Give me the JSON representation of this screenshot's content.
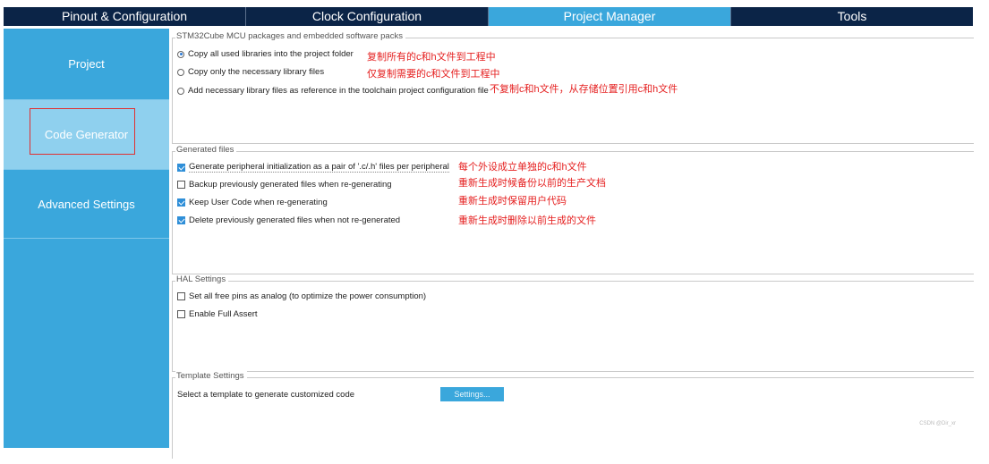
{
  "tabs": [
    "Pinout & Configuration",
    "Clock Configuration",
    "Project Manager",
    "Tools"
  ],
  "sidebar": {
    "items": [
      "Project",
      "Code Generator",
      "Advanced Settings"
    ]
  },
  "packages": {
    "legend": "STM32Cube MCU packages and embedded software packs",
    "options": [
      "Copy all used libraries into the project folder",
      "Copy only the necessary library files",
      "Add necessary library files as reference in the toolchain project configuration file"
    ],
    "notes": [
      "复制所有的c和h文件到工程中",
      "仅复制需要的c和文件到工程中",
      "不复制c和h文件，从存储位置引用c和h文件"
    ]
  },
  "generated": {
    "legend": "Generated files",
    "options": [
      "Generate peripheral initialization as a pair of '.c/.h' files per peripheral",
      "Backup previously generated files when re-generating",
      "Keep User Code when re-generating",
      "Delete previously generated files when not re-generated"
    ],
    "notes": [
      "每个外设成立单独的c和h文件",
      "重新生成时候备份以前的生产文档",
      "重新生成时保留用户代码",
      "重新生成时删除以前生成的文件"
    ]
  },
  "hal": {
    "legend": "HAL Settings",
    "options": [
      "Set all free pins as analog (to optimize the power consumption)",
      "Enable Full Assert"
    ]
  },
  "template": {
    "legend": "Template Settings",
    "label": "Select a template to generate customized code",
    "button": "Settings..."
  },
  "watermark": "CSDN @Dir_xr"
}
